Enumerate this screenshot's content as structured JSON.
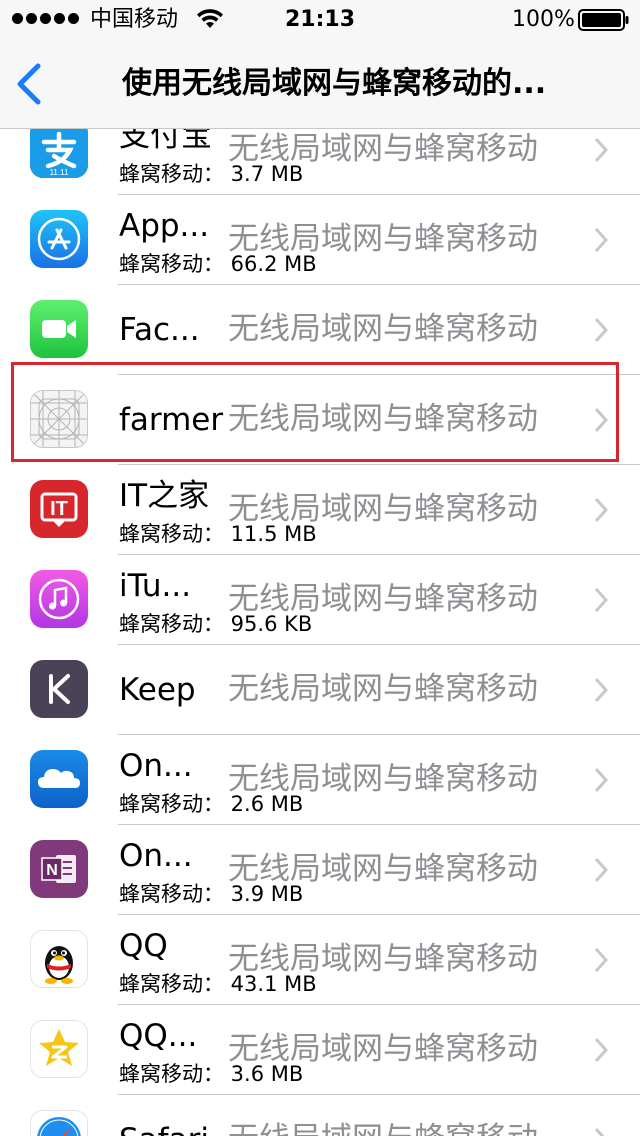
{
  "status_bar": {
    "carrier": "中国移动",
    "time": "21:13",
    "battery": "100%"
  },
  "nav": {
    "title": "使用无线局域网与蜂窝移动的..."
  },
  "apps": [
    {
      "name": "支付宝",
      "usage": "蜂窝移动：  3.7 MB",
      "status": "无线局域网与蜂窝移动",
      "icon": "alipay-icon"
    },
    {
      "name": "App...",
      "usage": "蜂窝移动：  66.2 MB",
      "status": "无线局域网与蜂窝移动",
      "icon": "app-store-icon"
    },
    {
      "name": "Fac...",
      "usage": "",
      "status": "无线局域网与蜂窝移动",
      "icon": "facetime-icon"
    },
    {
      "name": "farmer",
      "usage": "",
      "status": "无线局域网与蜂窝移动",
      "icon": "placeholder-app-icon"
    },
    {
      "name": "IT之家",
      "usage": "蜂窝移动：  11.5 MB",
      "status": "无线局域网与蜂窝移动",
      "icon": "ithome-icon"
    },
    {
      "name": "iTu...",
      "usage": "蜂窝移动：  95.6 KB",
      "status": "无线局域网与蜂窝移动",
      "icon": "itunes-icon"
    },
    {
      "name": "Keep",
      "usage": "",
      "status": "无线局域网与蜂窝移动",
      "icon": "keep-icon"
    },
    {
      "name": "On...",
      "usage": "蜂窝移动：  2.6 MB",
      "status": "无线局域网与蜂窝移动",
      "icon": "onedrive-icon"
    },
    {
      "name": "On...",
      "usage": "蜂窝移动：  3.9 MB",
      "status": "无线局域网与蜂窝移动",
      "icon": "onenote-icon"
    },
    {
      "name": "QQ",
      "usage": "蜂窝移动：  43.1 MB",
      "status": "无线局域网与蜂窝移动",
      "icon": "qq-icon"
    },
    {
      "name": "QQ...",
      "usage": "蜂窝移动：  3.6 MB",
      "status": "无线局域网与蜂窝移动",
      "icon": "qzone-icon"
    },
    {
      "name": "Safari",
      "usage": "",
      "status": "无线局域网与蜂窝移动",
      "icon": "safari-icon"
    }
  ],
  "colors": {
    "accent": "#1a7cfa",
    "secondary_text": "#8e8e93",
    "highlight": "#d9262c"
  }
}
